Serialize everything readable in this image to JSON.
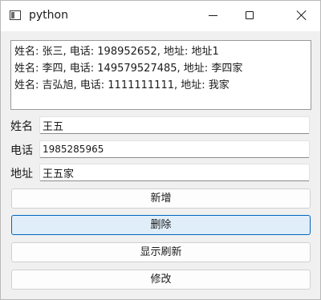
{
  "window": {
    "title": "python"
  },
  "list": {
    "items": [
      "姓名: 张三, 电话: 198952652, 地址: 地址1",
      "姓名: 李四, 电话: 149579527485, 地址: 李四家",
      "姓名: 吉弘旭, 电话: 1111111111, 地址: 我家"
    ]
  },
  "form": {
    "name_label": "姓名",
    "name_value": "王五",
    "phone_label": "电话",
    "phone_value": "1985285965",
    "address_label": "地址",
    "address_value": "王五家"
  },
  "buttons": {
    "add": "新增",
    "delete": "删除",
    "refresh": "显示刷新",
    "edit": "修改"
  },
  "icons": {
    "app": "window-icon",
    "minimize": "minimize-icon",
    "maximize": "maximize-icon",
    "close": "close-icon"
  },
  "colors": {
    "focus_border": "#0067c0",
    "focus_fill": "#e0eef9"
  }
}
